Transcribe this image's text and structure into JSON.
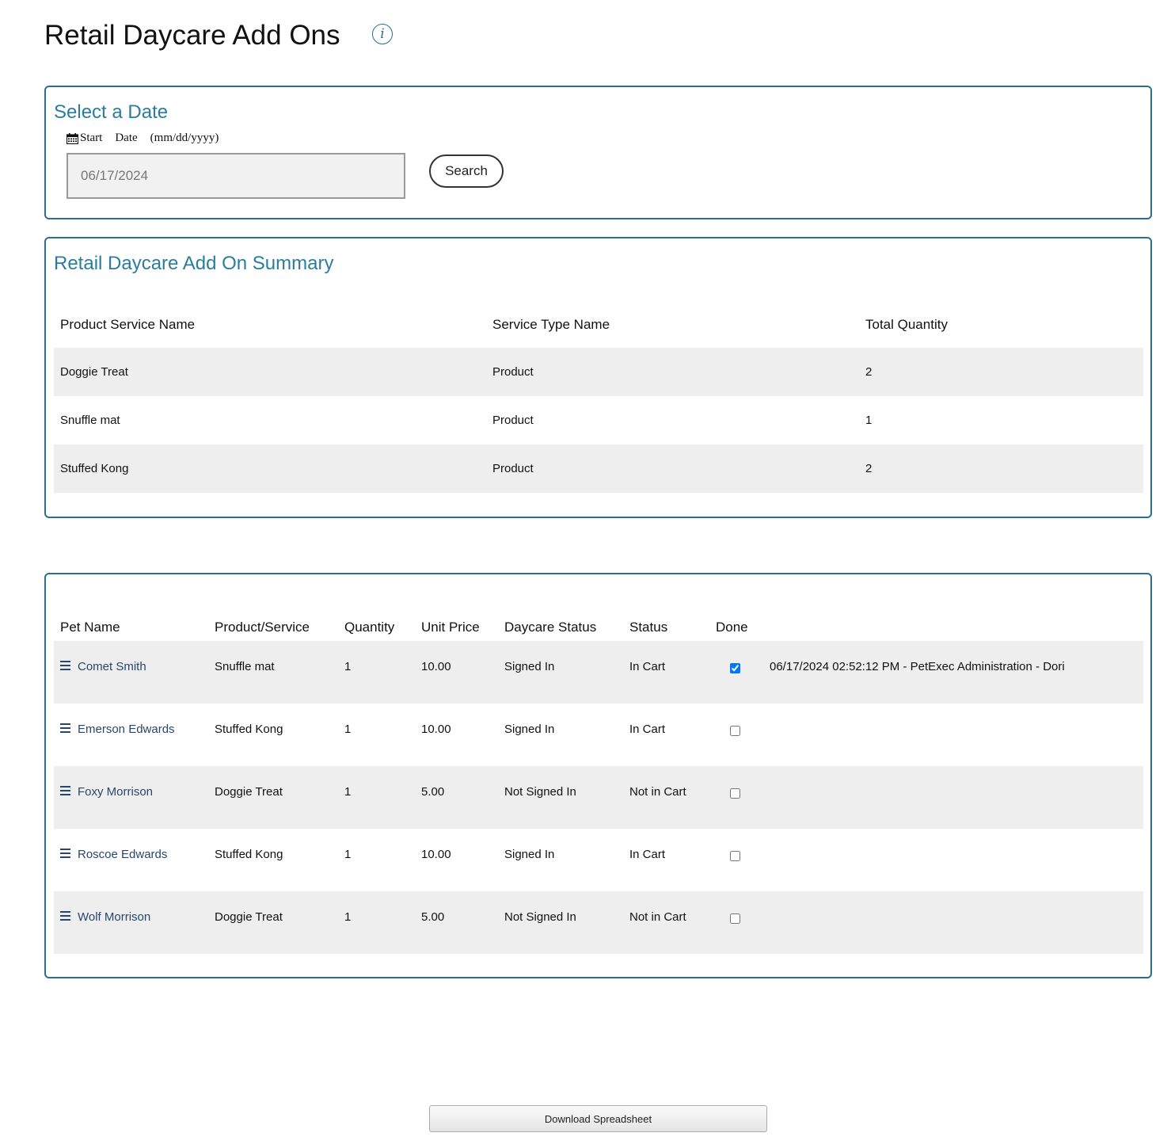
{
  "page": {
    "title": "Retail Daycare Add Ons",
    "info_icon": "info-icon",
    "info_glyph": "i"
  },
  "date_panel": {
    "heading": "Select a Date",
    "label_icon": "calendar-icon",
    "label_start": "Start",
    "label_date": "Date",
    "label_format": "(mm/dd/yyyy)",
    "date_value": "06/17/2024",
    "search_label": "Search"
  },
  "summary": {
    "heading": "Retail Daycare Add On Summary",
    "columns": [
      "Product Service Name",
      "Service Type Name",
      "Total Quantity"
    ],
    "rows": [
      {
        "name": "Doggie Treat",
        "type": "Product",
        "qty": "2"
      },
      {
        "name": "Snuffle mat",
        "type": "Product",
        "qty": "1"
      },
      {
        "name": "Stuffed Kong",
        "type": "Product",
        "qty": "2"
      }
    ]
  },
  "detail": {
    "columns": [
      "Pet Name",
      "Product/Service",
      "Quantity",
      "Unit Price",
      "Daycare Status",
      "Status",
      "Done"
    ],
    "rows": [
      {
        "pet": "Comet Smith",
        "product": "Snuffle mat",
        "qty": "1",
        "price": "10.00",
        "daycare": "Signed In",
        "status": "In Cart",
        "done": true,
        "note": "06/17/2024 02:52:12 PM - PetExec Administration - Dori"
      },
      {
        "pet": "Emerson Edwards",
        "product": "Stuffed Kong",
        "qty": "1",
        "price": "10.00",
        "daycare": "Signed In",
        "status": "In Cart",
        "done": false,
        "note": ""
      },
      {
        "pet": "Foxy Morrison",
        "product": "Doggie Treat",
        "qty": "1",
        "price": "5.00",
        "daycare": "Not Signed In",
        "status": "Not in Cart",
        "done": false,
        "note": ""
      },
      {
        "pet": "Roscoe Edwards",
        "product": "Stuffed Kong",
        "qty": "1",
        "price": "10.00",
        "daycare": "Signed In",
        "status": "In Cart",
        "done": false,
        "note": ""
      },
      {
        "pet": "Wolf Morrison",
        "product": "Doggie Treat",
        "qty": "1",
        "price": "5.00",
        "daycare": "Not Signed In",
        "status": "Not in Cart",
        "done": false,
        "note": ""
      }
    ],
    "row_icon": "menu-icon",
    "colors": {
      "in_cart": "#1a7a1a",
      "not_in_cart": "#e02020",
      "pet_link": "#27476e"
    }
  },
  "download_label": "Download Spreadsheet",
  "colors": {
    "accent": "#2a7d9e",
    "border": "#2a6f8f",
    "row_stripe": "#eeeeee"
  }
}
